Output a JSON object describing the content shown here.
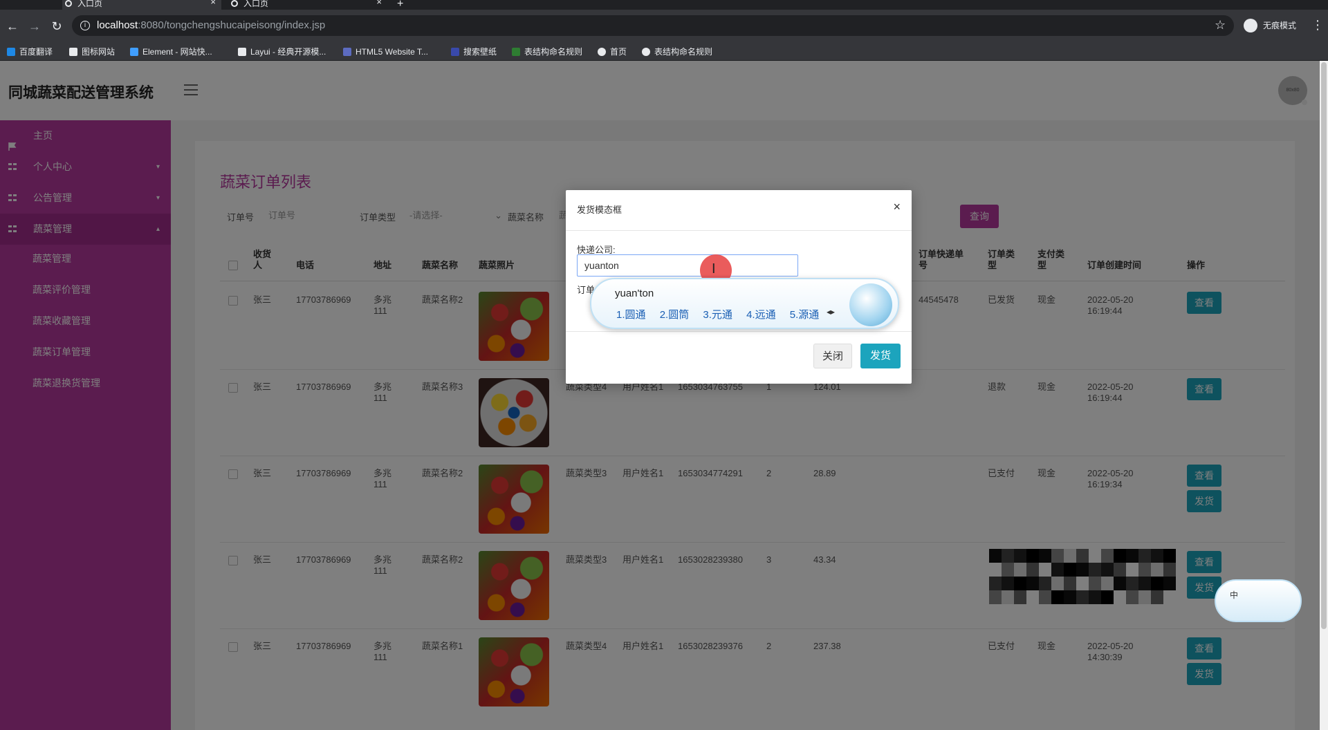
{
  "browser": {
    "tabs": [
      {
        "title": "入口页"
      },
      {
        "title": "入口页"
      }
    ],
    "new_tab": "+",
    "url_host": "localhost",
    "url_path": ":8080/tongchengshucaipeisong/index.jsp",
    "incognito_label": "无痕模式",
    "bookmarks": [
      {
        "label": "百度翻译",
        "color": "#1e88e5"
      },
      {
        "label": "图标网站",
        "color": "#e8eaed"
      },
      {
        "label": "Element - 网站快...",
        "color": "#409eff"
      },
      {
        "label": "Layui - 经典开源模...",
        "color": "#e8eaed"
      },
      {
        "label": "HTML5 Website T...",
        "color": "#5c6bc0"
      },
      {
        "label": "搜索壁纸",
        "color": "#3949ab"
      },
      {
        "label": "表结构命名规则",
        "color": "#2e7d32"
      },
      {
        "label": "首页",
        "color": "#e8eaed"
      },
      {
        "label": "表结构命名规则",
        "color": "#e8eaed"
      }
    ]
  },
  "app": {
    "title": "同城蔬菜配送管理系统",
    "accent": "#b6389f",
    "avatar_text": "80x80",
    "sidebar": {
      "items": [
        {
          "label": "主页",
          "icon": "flag-icon"
        },
        {
          "label": "个人中心",
          "icon": "grid-icon"
        },
        {
          "label": "公告管理",
          "icon": "grid-icon"
        },
        {
          "label": "蔬菜管理",
          "icon": "grid-icon"
        }
      ],
      "subitems": [
        "蔬菜管理",
        "蔬菜评价管理",
        "蔬菜收藏管理",
        "蔬菜订单管理",
        "蔬菜退换货管理"
      ]
    },
    "page_heading": "蔬菜订单列表",
    "filters": {
      "order_no_label": "订单号",
      "order_no_placeholder": "订单号",
      "order_type_label": "订单类型",
      "order_type_value": "-请选择-",
      "veg_name_label": "蔬菜名称",
      "veg_name_placeholder": "蔬",
      "query_button": "查询"
    },
    "table": {
      "headers": [
        "收货人",
        "电话",
        "地址",
        "蔬菜名称",
        "蔬菜照片",
        "订单快递单号",
        "订单类型",
        "支付类型",
        "订单创建时间",
        "操作"
      ],
      "rows": [
        {
          "receiver": "张三",
          "phone": "17703786969",
          "address": "多兆111",
          "veg_name": "蔬菜名称2",
          "veg_type": "",
          "user_name": "",
          "order_no": "",
          "qty": "",
          "price": "",
          "tracking": "44545478",
          "order_type": "已发货",
          "pay_type": "现金",
          "created": "2022-05-20 16:19:44",
          "img": "mix",
          "actions": [
            "查看"
          ]
        },
        {
          "receiver": "张三",
          "phone": "17703786969",
          "address": "多兆111",
          "veg_name": "蔬菜名称3",
          "veg_type": "蔬菜类型4",
          "user_name": "用户姓名1",
          "order_no": "1653034763755",
          "qty": "1",
          "price": "124.01",
          "tracking": "",
          "order_type": "退款",
          "pay_type": "现金",
          "created": "2022-05-20 16:19:44",
          "img": "pepper",
          "actions": [
            "查看"
          ]
        },
        {
          "receiver": "张三",
          "phone": "17703786969",
          "address": "多兆111",
          "veg_name": "蔬菜名称2",
          "veg_type": "蔬菜类型3",
          "user_name": "用户姓名1",
          "order_no": "1653034774291",
          "qty": "2",
          "price": "28.89",
          "tracking": "",
          "order_type": "已支付",
          "pay_type": "现金",
          "created": "2022-05-20 16:19:34",
          "img": "mix",
          "actions": [
            "查看",
            "发货"
          ]
        },
        {
          "receiver": "张三",
          "phone": "17703786969",
          "address": "多兆111",
          "veg_name": "蔬菜名称2",
          "veg_type": "蔬菜类型3",
          "user_name": "用户姓名1",
          "order_no": "1653028239380",
          "qty": "3",
          "price": "43.34",
          "tracking": "",
          "order_type": "",
          "pay_type": "",
          "created": "",
          "img": "mix",
          "actions": [
            "查看",
            "发货"
          ]
        },
        {
          "receiver": "张三",
          "phone": "17703786969",
          "address": "多兆111",
          "veg_name": "蔬菜名称1",
          "veg_type": "蔬菜类型4",
          "user_name": "用户姓名1",
          "order_no": "1653028239376",
          "qty": "2",
          "price": "237.38",
          "tracking": "",
          "order_type": "已支付",
          "pay_type": "现金",
          "created": "2022-05-20 14:30:39",
          "img": "mix",
          "actions": [
            "查看",
            "发货"
          ]
        }
      ]
    }
  },
  "modal": {
    "title": "发货模态框",
    "close_symbol": "×",
    "field_label": "快递公司:",
    "field_value": "yuanton",
    "field2_label": "订单",
    "close_button": "关闭",
    "ship_button": "发货"
  },
  "ime": {
    "composition": "yuan'ton",
    "candidates": [
      "1.圆通",
      "2.圆筒",
      "3.元通",
      "4.远通",
      "5.源通"
    ],
    "float_label": "中"
  }
}
